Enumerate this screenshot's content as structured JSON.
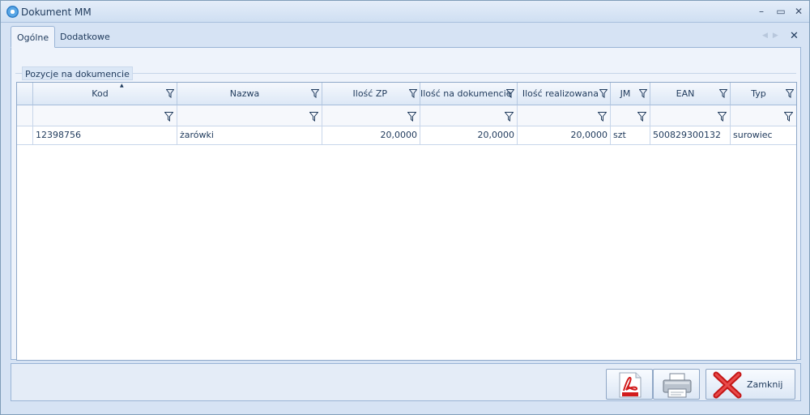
{
  "window": {
    "title": "Dokument MM",
    "controls": {
      "minimize": "–",
      "maximize": "▭",
      "close": "✕"
    }
  },
  "tabs": [
    {
      "label": "Ogólne",
      "active": true
    },
    {
      "label": "Dodatkowe",
      "active": false
    }
  ],
  "nav": {
    "prev": "◀",
    "next": "▶",
    "close": "✕"
  },
  "group": {
    "label": "Pozycje na dokumencie"
  },
  "grid": {
    "columns": [
      "Kod",
      "Nazwa",
      "Ilość ZP",
      "Ilość na dokumencie",
      "Ilość realizowana",
      "JM",
      "EAN",
      "Typ"
    ],
    "sorted_column": "Kod",
    "rows": [
      {
        "kod": "12398756",
        "nazwa": "żarówki",
        "ilosc_zp": "20,0000",
        "ilosc_na_dokumencie": "20,0000",
        "ilosc_realizowana": "20,0000",
        "jm": "szt",
        "ean": "500829300132",
        "typ": "surowiec"
      }
    ]
  },
  "buttons": {
    "pdf_icon": "pdf-icon",
    "print_icon": "printer-icon",
    "close_label": "Zamknij",
    "close_icon": "red-x-icon"
  },
  "colors": {
    "accent": "#1e395b",
    "header_bg": "#dde8f6",
    "close_red": "#d42020"
  }
}
